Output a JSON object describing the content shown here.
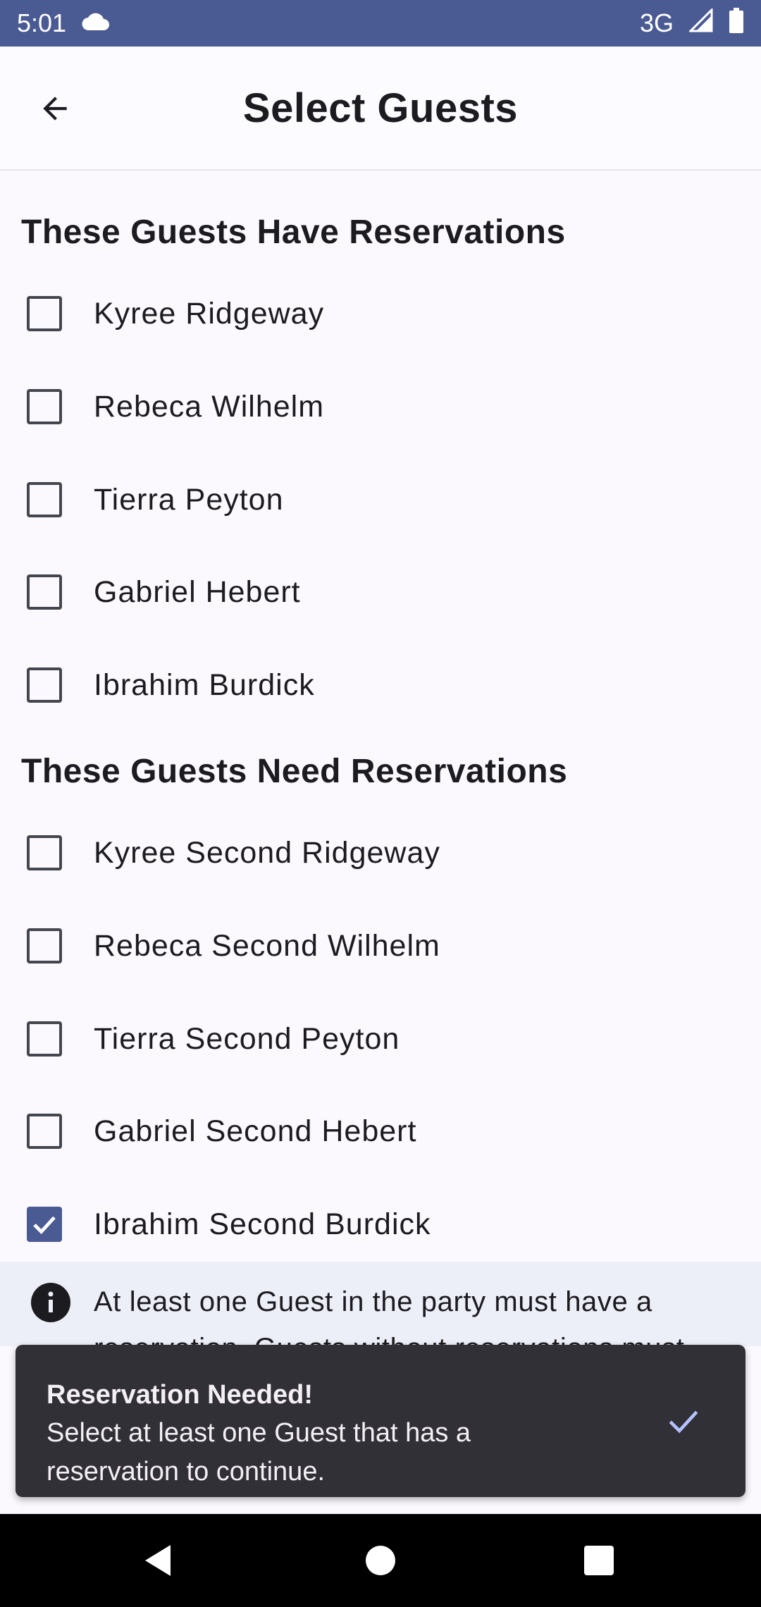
{
  "status_bar": {
    "time": "5:01",
    "cloud_icon": "cloud-icon",
    "network": "3G",
    "signal_icon": "signal-icon",
    "battery_icon": "battery-icon"
  },
  "app_bar": {
    "back_icon": "arrow-left-icon",
    "title": "Select Guests"
  },
  "sections": [
    {
      "header": "These Guests Have Reservations",
      "guests": [
        {
          "name": "Kyree Ridgeway",
          "checked": false
        },
        {
          "name": "Rebeca Wilhelm",
          "checked": false
        },
        {
          "name": "Tierra Peyton",
          "checked": false
        },
        {
          "name": "Gabriel Hebert",
          "checked": false
        },
        {
          "name": "Ibrahim Burdick",
          "checked": false
        }
      ]
    },
    {
      "header": "These Guests Need Reservations",
      "guests": [
        {
          "name": "Kyree Second Ridgeway",
          "checked": false
        },
        {
          "name": "Rebeca Second Wilhelm",
          "checked": false
        },
        {
          "name": "Tierra Second Peyton",
          "checked": false
        },
        {
          "name": "Gabriel Second Hebert",
          "checked": false
        },
        {
          "name": "Ibrahim Second Burdick",
          "checked": true
        }
      ]
    }
  ],
  "info_banner": {
    "icon": "info-icon",
    "text": "At least one Guest in the party must have a reservation. Guests without reservations must"
  },
  "snackbar": {
    "title": "Reservation Needed!",
    "message": "Select at least one Guest that has a reservation to continue.",
    "action_icon": "check-icon"
  },
  "nav_bar": {
    "back_icon": "nav-back-icon",
    "home_icon": "nav-home-icon",
    "recents_icon": "nav-recents-icon"
  },
  "colors": {
    "primary": "#4a5a93",
    "background": "#fbf9fe",
    "snackbar": "#313036",
    "snackbar_action": "#b4c3ff"
  }
}
